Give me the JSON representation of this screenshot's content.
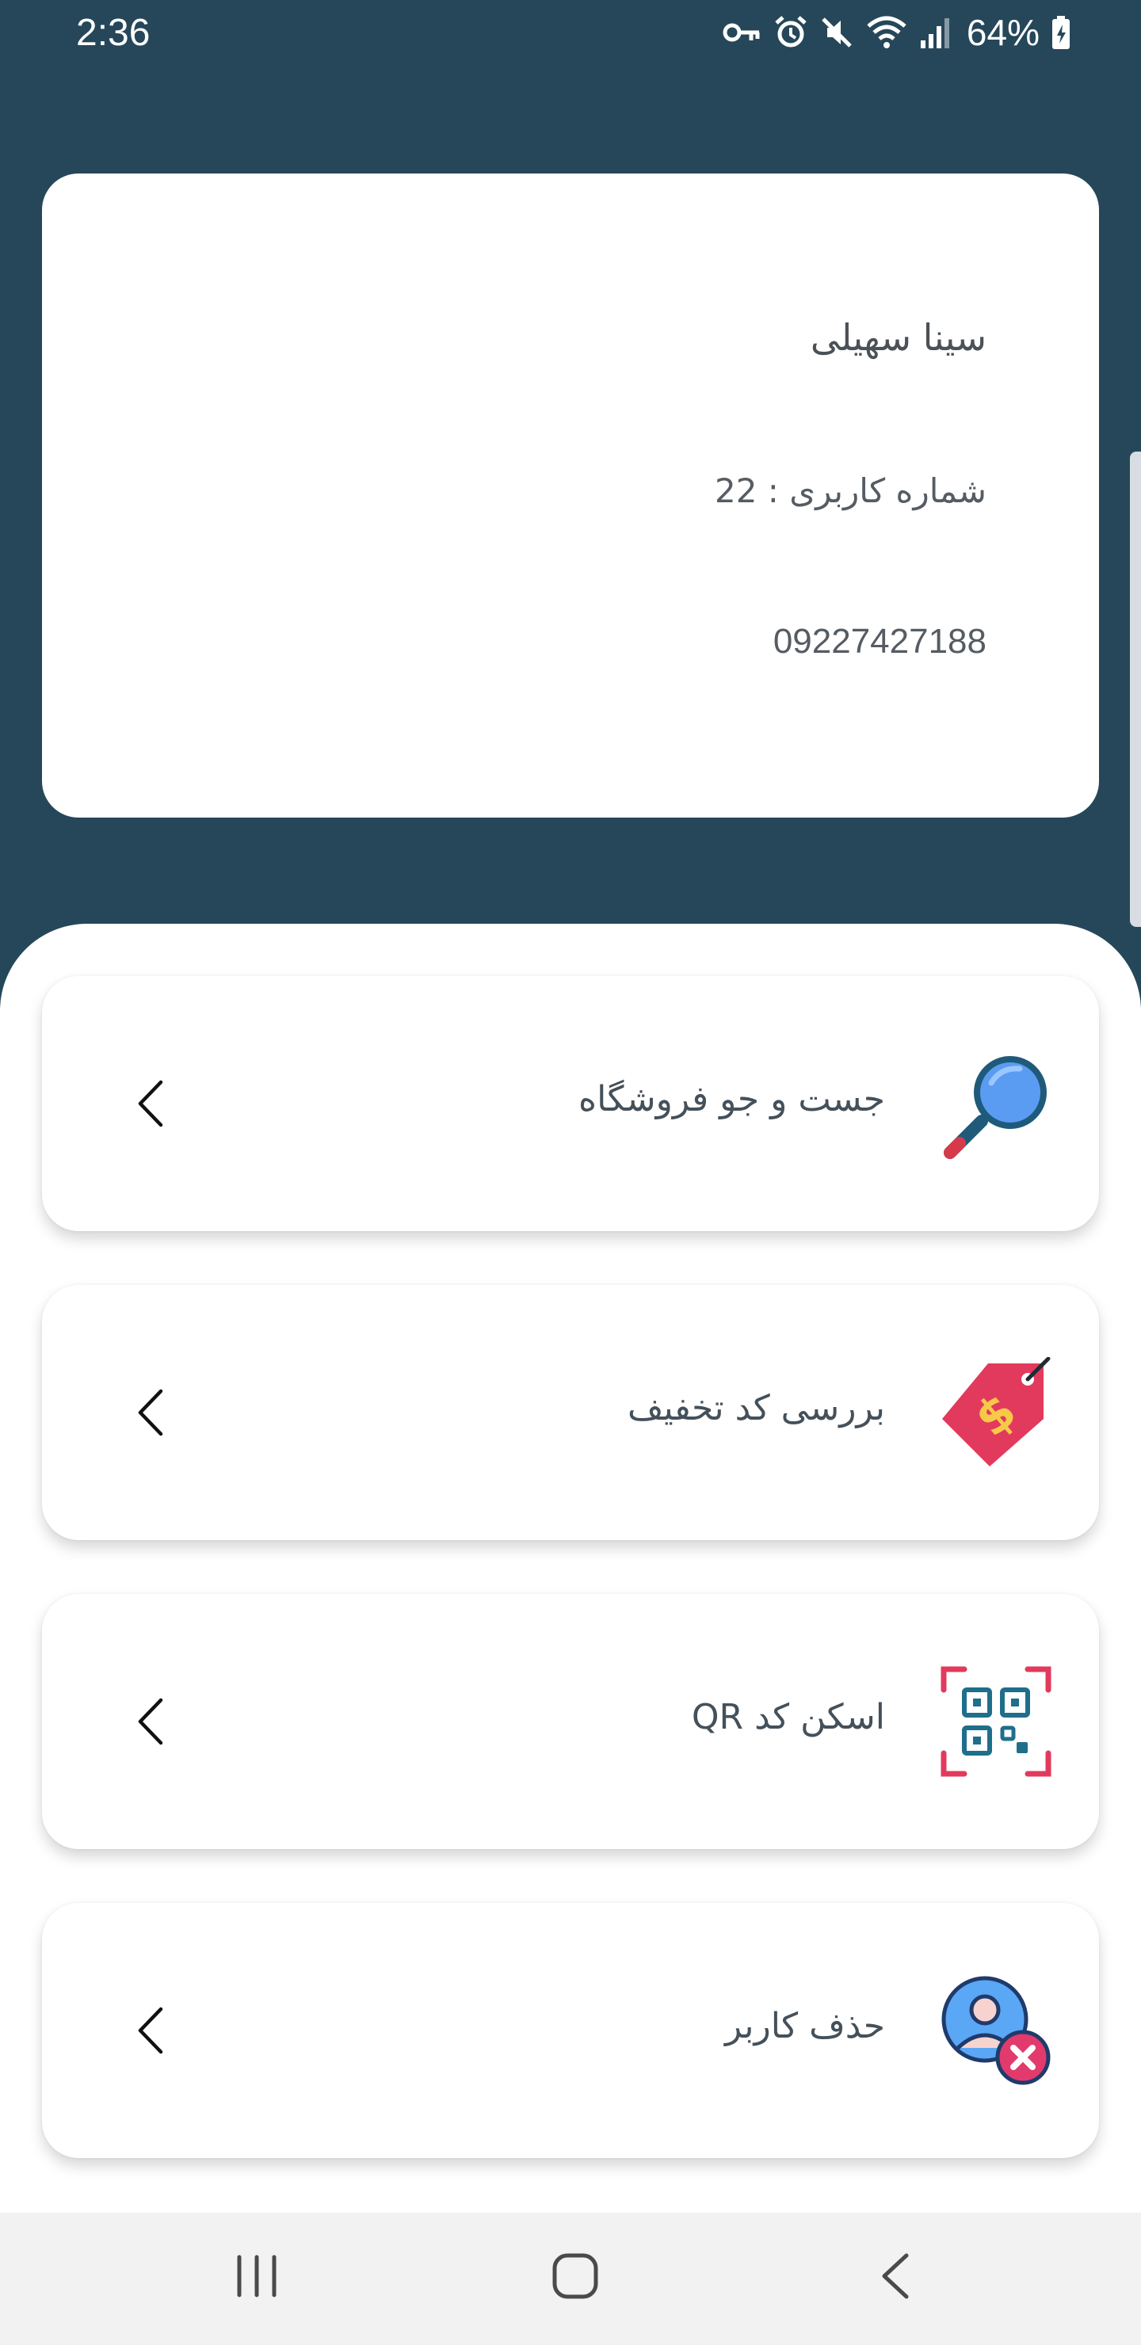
{
  "status_bar": {
    "time": "2:36",
    "battery": "64%",
    "icons": [
      "key-icon",
      "alarm-icon",
      "mute-icon",
      "wifi-icon",
      "signal-icon",
      "battery-charging-icon"
    ]
  },
  "profile": {
    "name": "سینا سهیلی",
    "user_number": "شماره کاربری : 22",
    "phone": "09227427188"
  },
  "menu": {
    "items": [
      {
        "label": "جست و جو فروشگاه",
        "icon": "magnifier-icon"
      },
      {
        "label": "بررسی کد تخفیف",
        "icon": "price-tag-icon"
      },
      {
        "label": "اسکن کد QR",
        "icon": "qr-code-icon"
      },
      {
        "label": "حذف کاربر",
        "icon": "delete-user-icon"
      }
    ]
  },
  "nav_bar": {
    "buttons": [
      "recent-apps-icon",
      "home-icon",
      "back-icon"
    ]
  },
  "colors": {
    "header_bg": "#254759",
    "card_bg": "#ffffff",
    "text": "#4b5157",
    "nav_bg": "#f2f2f2"
  }
}
